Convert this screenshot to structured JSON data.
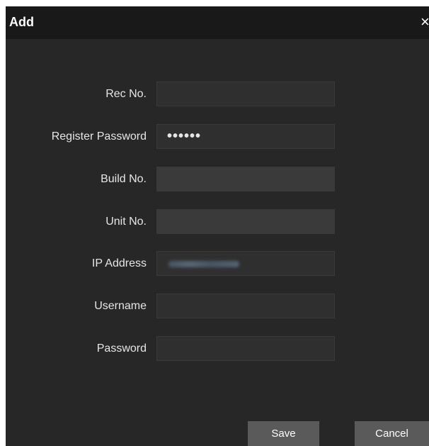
{
  "dialog": {
    "title": "Add",
    "close_glyph": "×"
  },
  "form": {
    "fields": [
      {
        "label": "Rec No.",
        "value": "",
        "type": "text"
      },
      {
        "label": "Register Password",
        "value": "••••••",
        "type": "password"
      },
      {
        "label": "Build No.",
        "value": "",
        "type": "text",
        "disabled": true
      },
      {
        "label": "Unit No.",
        "value": "",
        "type": "text",
        "disabled": true
      },
      {
        "label": "IP Address",
        "value": "",
        "type": "text",
        "blurred": true
      },
      {
        "label": "Username",
        "value": "",
        "type": "text"
      },
      {
        "label": "Password",
        "value": "",
        "type": "password"
      }
    ]
  },
  "buttons": {
    "save": "Save",
    "cancel": "Cancel"
  },
  "colors": {
    "dialog_bg": "#272727",
    "titlebar_bg": "#191919",
    "field_bg": "#2f2f2f",
    "field_disabled_bg": "#3a3a3a",
    "button_bg": "#5a5a5a"
  }
}
